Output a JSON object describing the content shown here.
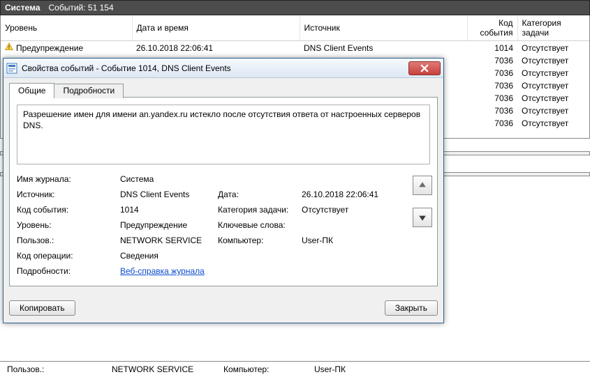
{
  "header": {
    "log_name": "Система",
    "events_label": "Событий: 51 154"
  },
  "columns": {
    "level": "Уровень",
    "datetime": "Дата и время",
    "source": "Источник",
    "event_id": "Код события",
    "task": "Категория задачи"
  },
  "rows": [
    {
      "icon": "warn",
      "level": "Предупреждение",
      "datetime": "26.10.2018 22:06:41",
      "source": "DNS Client Events",
      "event_id": "1014",
      "task": "Отсутствует"
    },
    {
      "icon": "",
      "level": "",
      "datetime": "",
      "source": "",
      "event_id": "7036",
      "task": "Отсутствует"
    },
    {
      "icon": "",
      "level": "",
      "datetime": "",
      "source": "",
      "event_id": "7036",
      "task": "Отсутствует"
    },
    {
      "icon": "",
      "level": "",
      "datetime": "",
      "source": "",
      "event_id": "7036",
      "task": "Отсутствует"
    },
    {
      "icon": "",
      "level": "",
      "datetime": "",
      "source": "",
      "event_id": "7036",
      "task": "Отсутствует"
    },
    {
      "icon": "",
      "level": "",
      "datetime": "",
      "source": "",
      "event_id": "7036",
      "task": "Отсутствует"
    },
    {
      "icon": "",
      "level": "",
      "datetime": "",
      "source": "",
      "event_id": "7036",
      "task": "Отсутствует"
    }
  ],
  "dialog": {
    "title": "Свойства событий - Событие 1014, DNS Client Events",
    "tabs": {
      "general": "Общие",
      "details": "Подробности"
    },
    "description": "Разрешение имен для имени an.yandex.ru истекло после отсутствия ответа от настроенных серверов DNS.",
    "labels": {
      "log": "Имя журнала:",
      "source": "Источник:",
      "event_id": "Код события:",
      "level": "Уровень:",
      "user": "Пользов.:",
      "opcode": "Код операции:",
      "more": "Подробности:",
      "date": "Дата:",
      "task": "Категория задачи:",
      "keywords": "Ключевые слова:",
      "computer": "Компьютер:"
    },
    "values": {
      "log": "Система",
      "source": "DNS Client Events",
      "event_id": "1014",
      "level": "Предупреждение",
      "user": "NETWORK SERVICE",
      "opcode": "Сведения",
      "more_link": "Веб-справка журнала",
      "date": "26.10.2018 22:06:41",
      "task": "Отсутствует",
      "keywords": "",
      "computer": "User-ПК"
    },
    "buttons": {
      "copy": "Копировать",
      "close": "Закрыть"
    }
  },
  "ghost": {
    "user_lbl": "Пользов.:",
    "user_val": "NETWORK SERVICE",
    "comp_lbl": "Компьютер:",
    "comp_val": "User-ПК"
  }
}
